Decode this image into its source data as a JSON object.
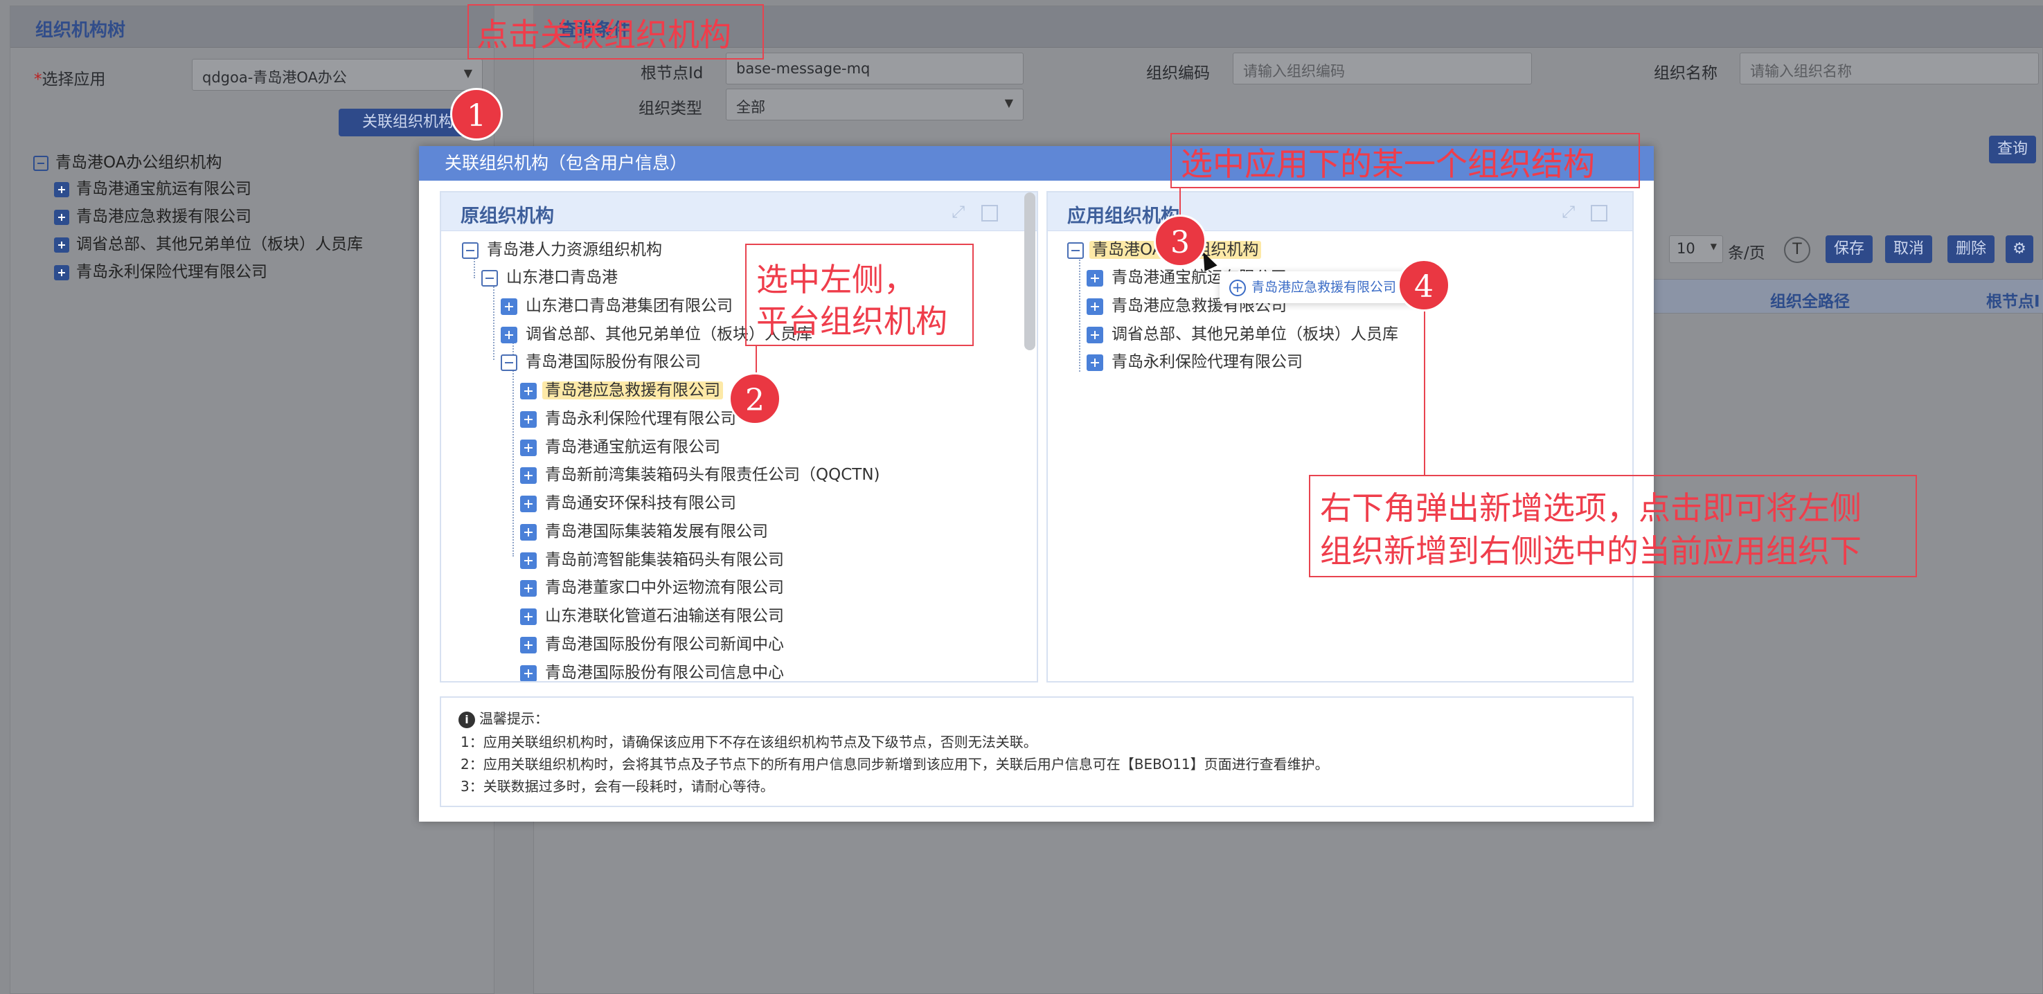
{
  "background": {
    "left_panel": {
      "title": "组织机构树",
      "select_app_label": "选择应用",
      "select_app_value": "qdgoa-青岛港OA办公",
      "link_button": "关联组织机构",
      "tree": [
        {
          "label": "青岛港OA办公组织机构",
          "expanded": true
        },
        {
          "label": "青岛港通宝航运有限公司"
        },
        {
          "label": "青岛港应急救援有限公司"
        },
        {
          "label": "调省总部、其他兄弟单位（板块）人员库"
        },
        {
          "label": "青岛永利保险代理有限公司"
        }
      ]
    },
    "right_panel": {
      "title": "查询条件",
      "root_id_label": "根节点Id",
      "root_id_value": "base-message-mq",
      "org_code_label": "组织编码",
      "org_code_placeholder": "请输入组织编码",
      "org_name_label": "组织名称",
      "org_name_placeholder": "请输入组织名称",
      "org_type_label": "组织类型",
      "org_type_value": "全部",
      "query_button": "查询",
      "page_size": "10",
      "per_page_label": "条/页",
      "save_button": "保存",
      "cancel_button": "取消",
      "delete_button": "删除",
      "col_full_path": "组织全路径",
      "col_root_node": "根节点I"
    }
  },
  "modal": {
    "title": "关联组织机构（包含用户信息）",
    "left_panel": {
      "title": "原组织机构",
      "nodes": [
        {
          "label": "青岛港人力资源组织机构",
          "type": "minus",
          "level": 0
        },
        {
          "label": "山东港口青岛港",
          "type": "minus",
          "level": 1
        },
        {
          "label": "山东港口青岛港集团有限公司",
          "type": "plus",
          "level": 2
        },
        {
          "label": "调省总部、其他兄弟单位（板块）人员库",
          "type": "plus",
          "level": 2
        },
        {
          "label": "青岛港国际股份有限公司",
          "type": "minus",
          "level": 2
        },
        {
          "label": "青岛港应急救援有限公司",
          "type": "plus",
          "level": 3,
          "selected": true
        },
        {
          "label": "青岛永利保险代理有限公司",
          "type": "plus",
          "level": 3
        },
        {
          "label": "青岛港通宝航运有限公司",
          "type": "plus",
          "level": 3
        },
        {
          "label": "青岛新前湾集装箱码头有限责任公司（QQCTN)",
          "type": "plus",
          "level": 3
        },
        {
          "label": "青岛通安环保科技有限公司",
          "type": "plus",
          "level": 3
        },
        {
          "label": "青岛港国际集装箱发展有限公司",
          "type": "plus",
          "level": 3
        },
        {
          "label": "青岛前湾智能集装箱码头有限公司",
          "type": "plus",
          "level": 3
        },
        {
          "label": "青岛港董家口中外运物流有限公司",
          "type": "plus",
          "level": 3
        },
        {
          "label": "山东港联化管道石油输送有限公司",
          "type": "plus",
          "level": 3
        },
        {
          "label": "青岛港国际股份有限公司新闻中心",
          "type": "plus",
          "level": 3
        },
        {
          "label": "青岛港国际股份有限公司信息中心",
          "type": "plus",
          "level": 3
        }
      ]
    },
    "right_panel": {
      "title": "应用组织机构",
      "nodes": [
        {
          "label": "青岛港OA办公组织机构",
          "type": "minus",
          "level": 0,
          "selected": true
        },
        {
          "label": "青岛港通宝航运有限公司",
          "type": "plus",
          "level": 1
        },
        {
          "label": "青岛港应急救援有限公司",
          "type": "plus",
          "level": 1
        },
        {
          "label": "调省总部、其他兄弟单位（板块）人员库",
          "type": "plus",
          "level": 1
        },
        {
          "label": "青岛永利保险代理有限公司",
          "type": "plus",
          "level": 1
        }
      ],
      "popup_label": "青岛港应急救援有限公司"
    },
    "tips": {
      "title": "温馨提示：",
      "lines": [
        "1：应用关联组织机构时，请确保该应用下不存在该组织机构节点及下级节点，否则无法关联。",
        "2：应用关联组织机构时，会将其节点及子节点下的所有用户信息同步新增到该应用下，关联后用户信息可在【BEBO11】页面进行查看维护。",
        "3：关联数据过多时，会有一段耗时，请耐心等待。"
      ]
    }
  },
  "annotations": {
    "a1": "点击关联组织机构",
    "a2_line1": "选中左侧，",
    "a2_line2": "平台组织机构",
    "a3": "选中应用下的某一个组织结构",
    "a4_line1": "右下角弹出新增选项，点击即可将左侧",
    "a4_line2": "组织新增到右侧选中的当前应用组织下",
    "badges": [
      "1",
      "2",
      "3",
      "4"
    ]
  },
  "colors": {
    "accent": "#5f87d6",
    "annotation_red": "#ea3742",
    "selected_highlight": "#fde9a7"
  }
}
